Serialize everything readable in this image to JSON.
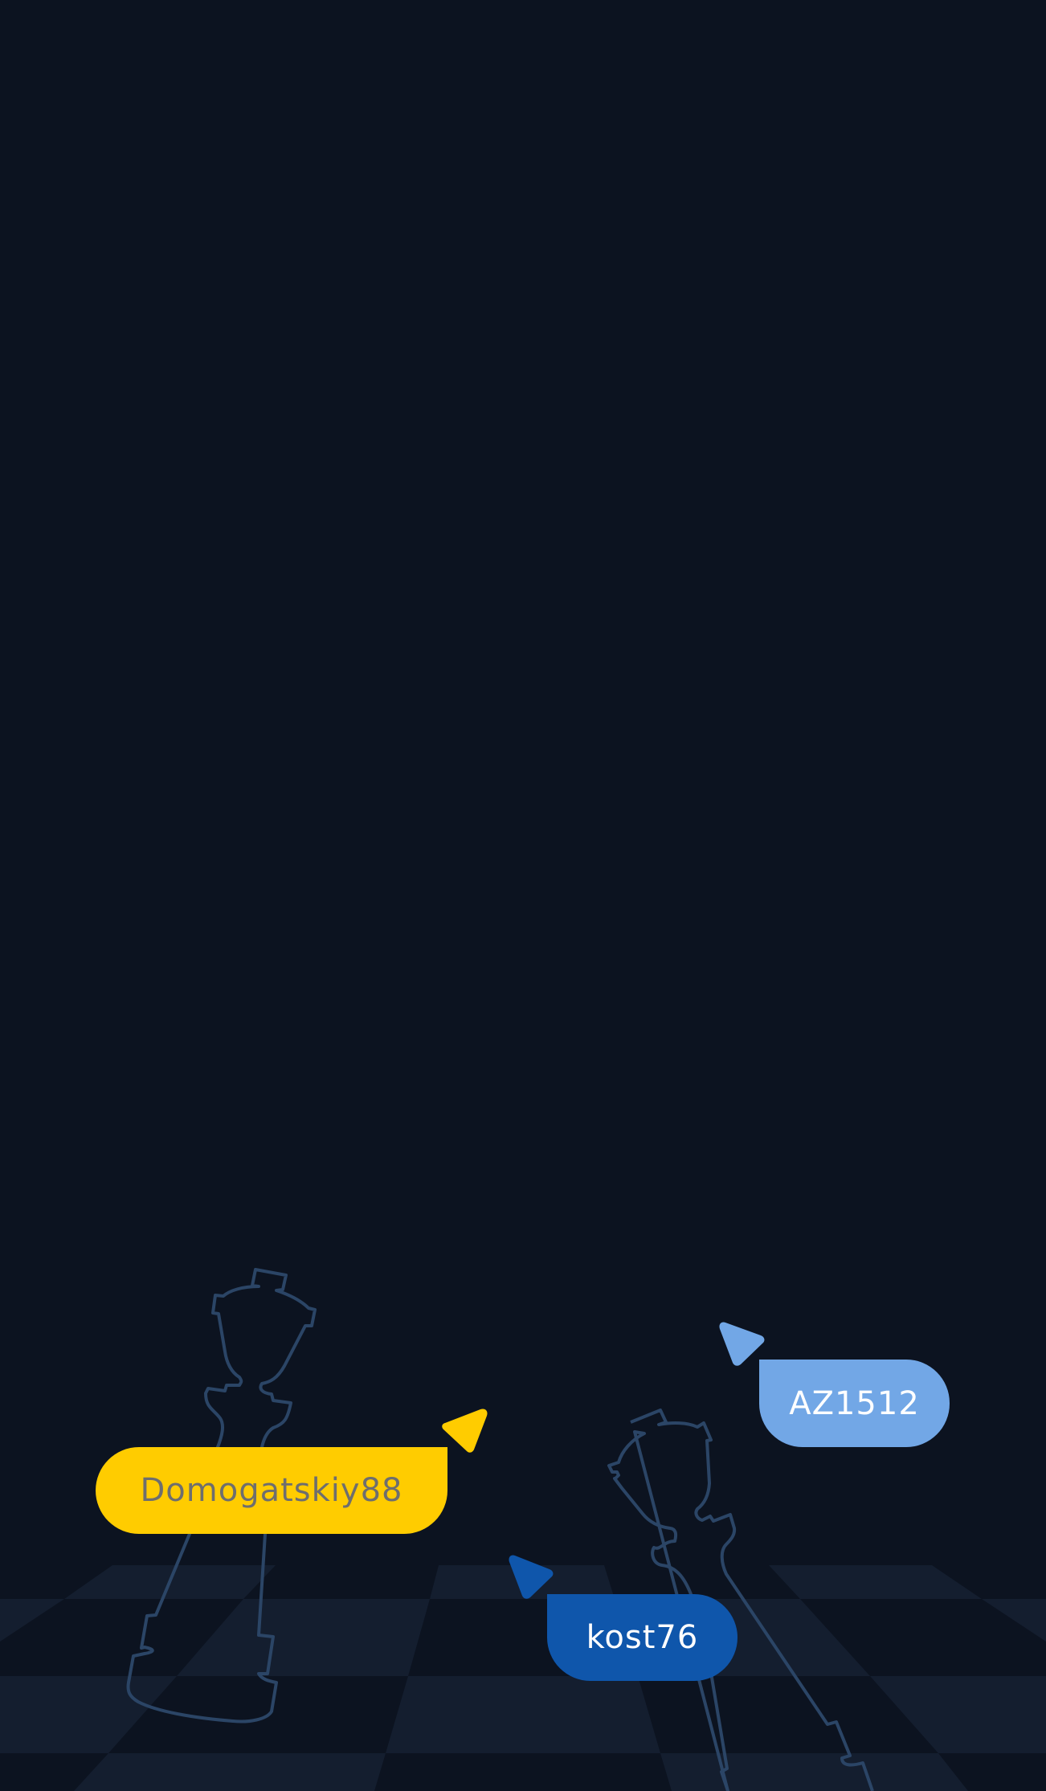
{
  "players": [
    {
      "id": "yellow",
      "name": "Domogatskiy88",
      "bg": "#ffcc00",
      "fg": "#6e6e6e"
    },
    {
      "id": "lightblue",
      "name": "AZ1512",
      "bg": "#72a7e6",
      "fg": "#ffffff"
    },
    {
      "id": "blue",
      "name": "kost76",
      "bg": "#0f56ab",
      "fg": "#ffffff"
    }
  ],
  "colors": {
    "background": "#0c1320",
    "board_light": "#141e2f",
    "board_dark": "#0c1320",
    "piece_outline": "#2b4566"
  },
  "icons": {
    "left_piece": "queen-outline-icon",
    "right_piece": "knight-outline-icon",
    "cursor": "pointer-arrow-icon"
  }
}
